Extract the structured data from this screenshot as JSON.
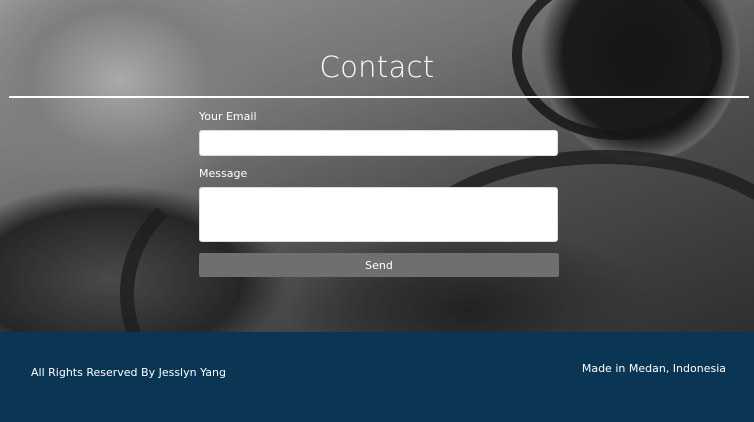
{
  "contact": {
    "title": "Contact",
    "email_label": "Your Email",
    "email_value": "",
    "message_label": "Message",
    "message_value": "",
    "send_label": "Send"
  },
  "footer": {
    "copyright": "All Rights Reserved By Jesslyn Yang",
    "location": "Made in Medan, Indonesia"
  },
  "colors": {
    "footer_bg": "#0b3555",
    "button_bg": "#6f6f6f",
    "text": "#ffffff"
  }
}
